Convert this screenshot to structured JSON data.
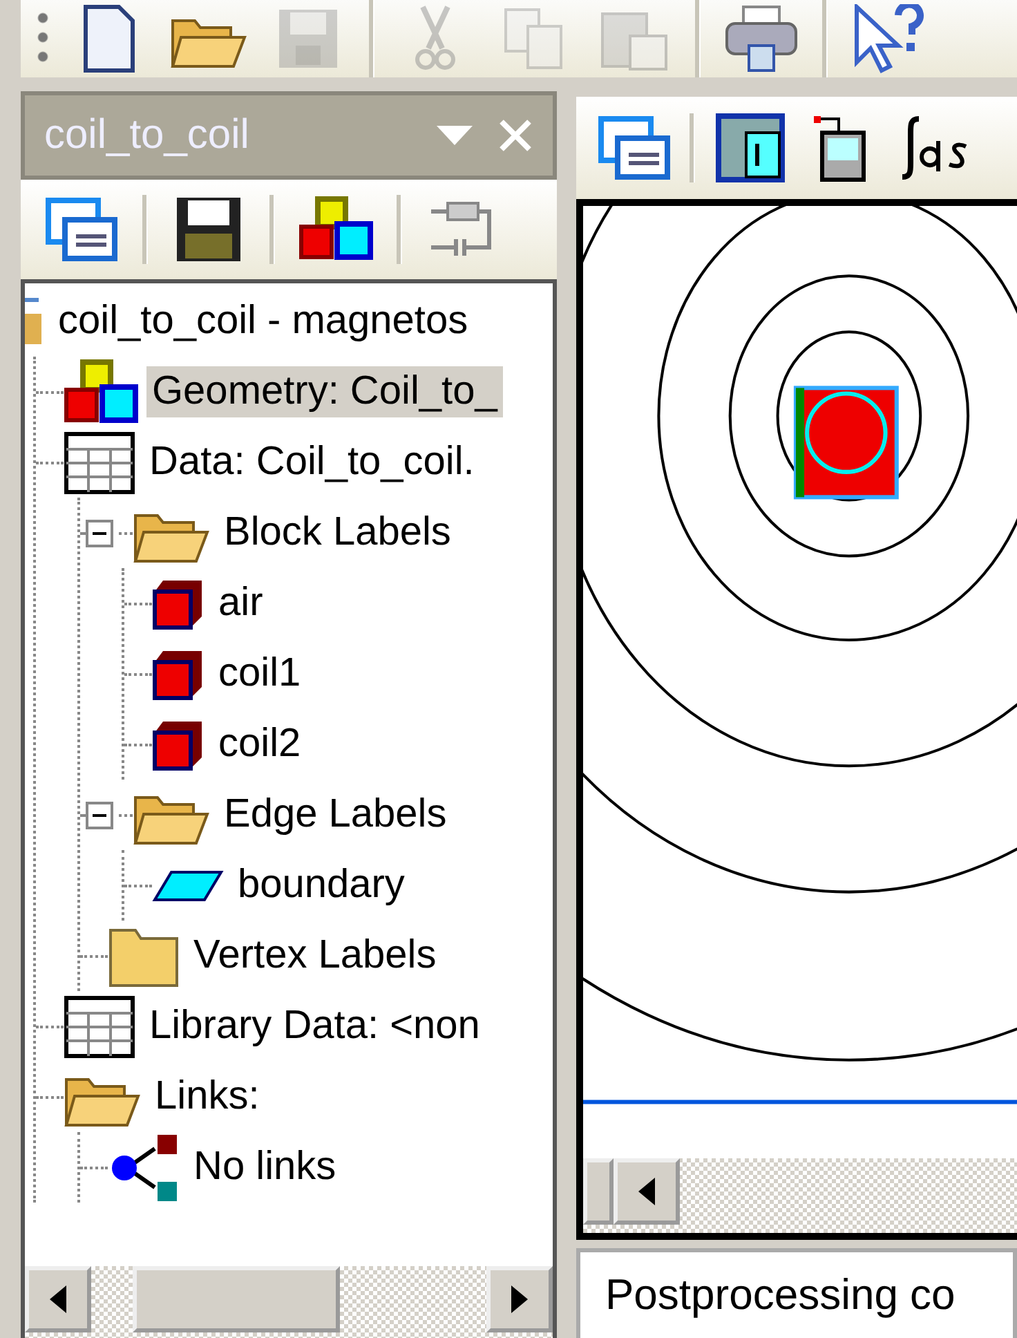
{
  "toolbar": {
    "buttons": [
      {
        "kind": "new",
        "disabled": false
      },
      {
        "kind": "open",
        "disabled": false
      },
      {
        "kind": "save",
        "disabled": true
      },
      {
        "kind": "cut",
        "disabled": true
      },
      {
        "kind": "copy",
        "disabled": true
      },
      {
        "kind": "paste",
        "disabled": true
      },
      {
        "kind": "print",
        "disabled": false
      },
      {
        "kind": "help",
        "disabled": false
      }
    ]
  },
  "project_panel": {
    "title": "coil_to_coil",
    "toolbar": [
      {
        "kind": "window"
      },
      {
        "kind": "disk"
      },
      {
        "kind": "blocks"
      },
      {
        "kind": "circuit"
      }
    ],
    "tree": [
      {
        "label": "coil_to_coil - magnetos",
        "kind": "root",
        "selected": false,
        "children": [
          {
            "label": "Geometry: Coil_to_",
            "kind": "geometry",
            "selected": true
          },
          {
            "label": "Data: Coil_to_coil.",
            "kind": "table",
            "selected": false,
            "children": [
              {
                "label": "Block Labels",
                "kind": "folder-open",
                "selected": false,
                "expanded": true,
                "children": [
                  {
                    "label": "air",
                    "kind": "block",
                    "selected": false
                  },
                  {
                    "label": "coil1",
                    "kind": "block",
                    "selected": false
                  },
                  {
                    "label": "coil2",
                    "kind": "block",
                    "selected": false
                  }
                ]
              },
              {
                "label": "Edge Labels",
                "kind": "folder-open",
                "selected": false,
                "expanded": true,
                "children": [
                  {
                    "label": "boundary",
                    "kind": "edge",
                    "selected": false
                  }
                ]
              },
              {
                "label": "Vertex Labels",
                "kind": "folder",
                "selected": false
              }
            ]
          },
          {
            "label": "Library Data: <non",
            "kind": "table",
            "selected": false
          },
          {
            "label": "Links:",
            "kind": "folder-open",
            "selected": false,
            "children": [
              {
                "label": "No links",
                "kind": "link",
                "selected": false
              }
            ]
          }
        ]
      }
    ]
  },
  "view": {
    "toolbar": [
      {
        "kind": "window"
      },
      {
        "kind": "table"
      },
      {
        "kind": "probe"
      },
      {
        "kind": "integral"
      }
    ],
    "status": "Postprocessing co"
  }
}
